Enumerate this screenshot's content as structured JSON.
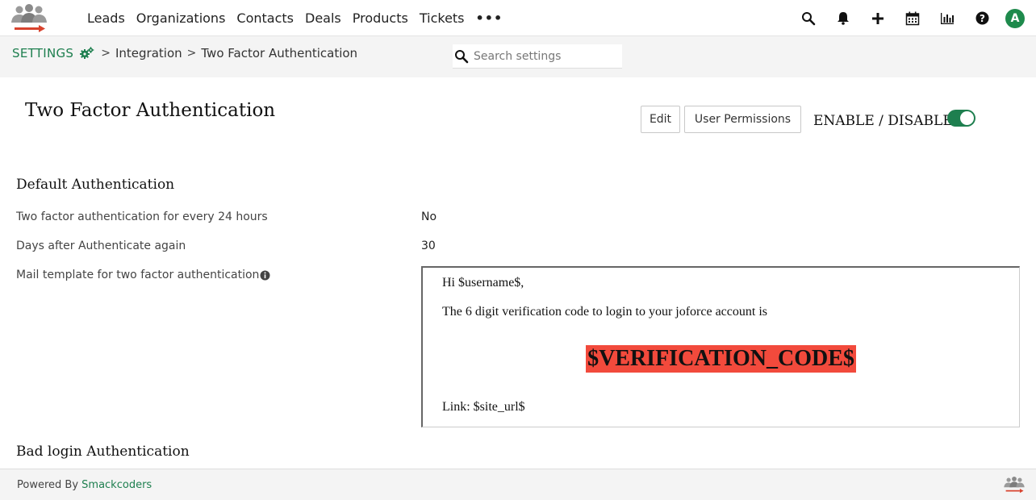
{
  "nav": {
    "items": [
      "Leads",
      "Organizations",
      "Contacts",
      "Deals",
      "Products",
      "Tickets"
    ],
    "more": "•••",
    "avatar_letter": "A"
  },
  "breadcrumb": {
    "settings": "SETTINGS",
    "integration": "Integration",
    "current": "Two Factor Authentication",
    "separator": ">"
  },
  "search": {
    "placeholder": "Search settings"
  },
  "header": {
    "title": "Two Factor Authentication",
    "edit_label": "Edit",
    "permissions_label": "User Permissions",
    "enable_label": "ENABLE / DISABLE",
    "enabled": true
  },
  "default_auth": {
    "title": "Default Authentication",
    "fields": [
      {
        "label": "Two factor authentication for every 24 hours",
        "value": "No"
      },
      {
        "label": "Days after Authenticate again",
        "value": "30"
      },
      {
        "label": "Mail template for two factor authentication",
        "value": ""
      }
    ]
  },
  "mail_template": {
    "greeting": "Hi $username$,",
    "body": "The 6 digit verification code to login to your joforce account is",
    "code": "$VERIFICATION_CODE$",
    "link": "Link: $site_url$"
  },
  "bad_login": {
    "title": "Bad login Authentication"
  },
  "footer": {
    "powered_by": "Powered By ",
    "company": "Smackcoders"
  },
  "colors": {
    "brand_green": "#1e7f4f",
    "code_highlight": "#f24a3c",
    "logo_red": "#d8432e"
  }
}
